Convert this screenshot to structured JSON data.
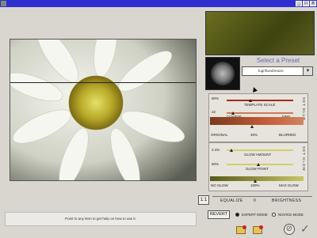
{
  "window": {
    "close_glyph": "x",
    "max_glyph": "□",
    "min_glyph": "_"
  },
  "preset": {
    "title": "Select a Preset",
    "value": "fugr/fixed/resize"
  },
  "set_blur": {
    "side_label": "SET BLUR",
    "template_scale_value": "80%",
    "template_scale_label": "TEMPLATE SCALE",
    "coarse_fine_value": "22",
    "coarse_label": "COARSE",
    "fine_label": "FINE",
    "original_label": "ORIGINAL",
    "blur_value": "46%",
    "blurred_label": "BLURRED"
  },
  "set_glow": {
    "side_label": "SET GLOW",
    "glow_amount_value": "2.4%",
    "glow_amount_label": "GLOW AMOUNT",
    "glow_point_value": "50%",
    "glow_point_label": "GLOW POINT",
    "no_glow_label": "NO GLOW",
    "glow_value": "100%",
    "max_glow_label": "MAX GLOW"
  },
  "controls": {
    "ratio_label": "1:1",
    "equalize_label": "EQUALIZE",
    "equalize_value": "0",
    "brightness_label": "BRIGHTNESS",
    "revert_label": "REVERT",
    "expert_mode_label": "EXPERT MODE",
    "novice_mode_label": "NOVICE MODE"
  },
  "help_text": "Point to any item to get help on how to use it.",
  "colors": {
    "titlebar": "#2f2fd0",
    "preset_title": "#6b66b0",
    "slider_red": "#a32a1e",
    "slider_yellow": "#d2cf6a"
  }
}
